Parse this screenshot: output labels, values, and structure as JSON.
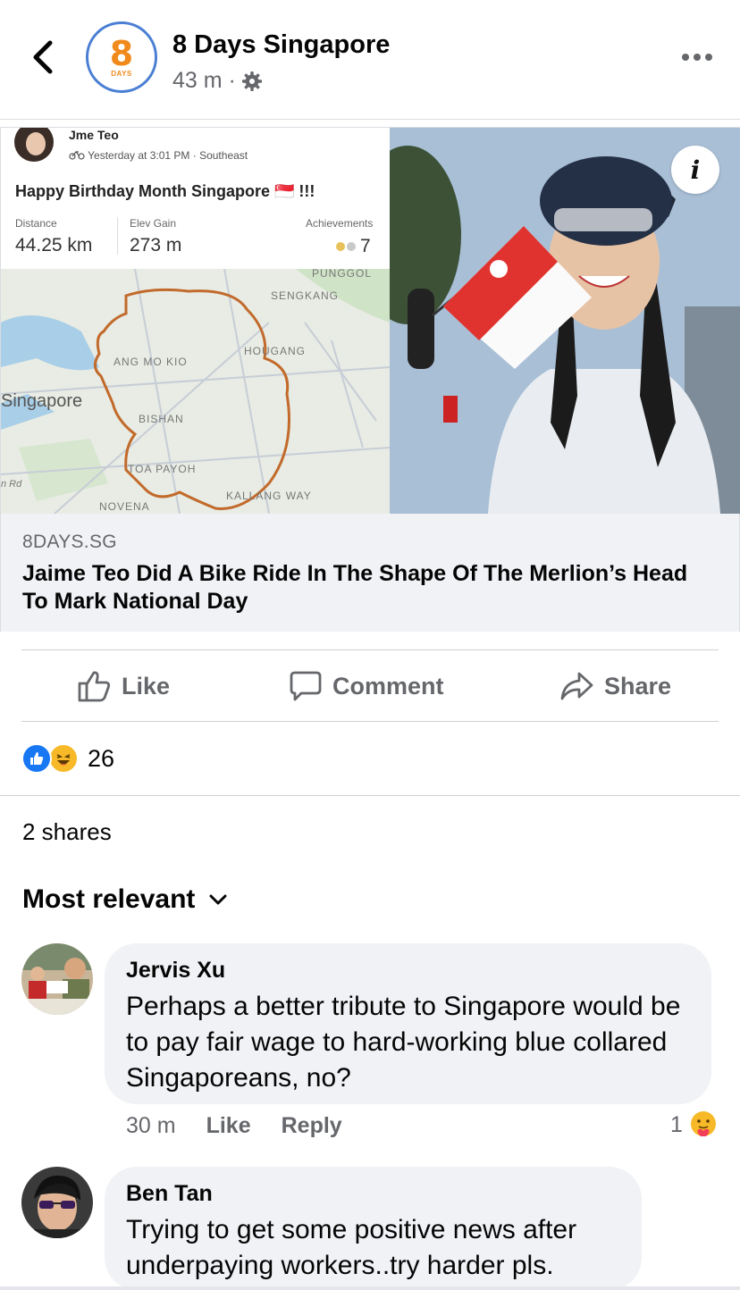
{
  "header": {
    "page_name": "8 Days Singapore",
    "post_time": "43 m ·",
    "avatar_text": "8",
    "avatar_subtext": "DAYS"
  },
  "link_card": {
    "strava": {
      "user_name": "Jme Teo",
      "activity_time": "Yesterday at 3:01 PM · Southeast",
      "title": "Happy Birthday Month Singapore 🇸🇬 !!!",
      "stats": [
        {
          "label": "Distance",
          "value": "44.25 km"
        },
        {
          "label": "Elev Gain",
          "value": "273 m"
        },
        {
          "label": "Achievements",
          "value": "7"
        }
      ],
      "map_labels": [
        "PUNGGOL",
        "SENGKANG",
        "HOUGANG",
        "ANG MO KIO",
        "Singapore",
        "BISHAN",
        "TOA PAYOH",
        "NOVENA",
        "KALLANG WAY",
        "n Rd"
      ]
    },
    "domain": "8DAYS.SG",
    "title": "Jaime Teo Did A Bike Ride In The Shape Of The Merlion’s Head To Mark National Day"
  },
  "actions": {
    "like": "Like",
    "comment": "Comment",
    "share": "Share"
  },
  "reactions": {
    "count": "26"
  },
  "shares_text": "2 shares",
  "sort_label": "Most relevant",
  "comments": [
    {
      "name": "Jervis Xu",
      "text": "Perhaps a better tribute to Singapore would be to pay fair wage to hard-working blue collared Singaporeans, no?",
      "time": "30 m",
      "like": "Like",
      "reply": "Reply",
      "reaction_count": "1"
    },
    {
      "name": "Ben Tan",
      "text": "Trying to get some positive news after underpaying workers..try harder pls."
    }
  ],
  "colors": {
    "brand_blue": "#1877f2",
    "secondary_text": "#65676b",
    "bubble_bg": "#f0f2f5",
    "strava_route": "#c26a2b",
    "logo_orange": "#f08a1c"
  }
}
